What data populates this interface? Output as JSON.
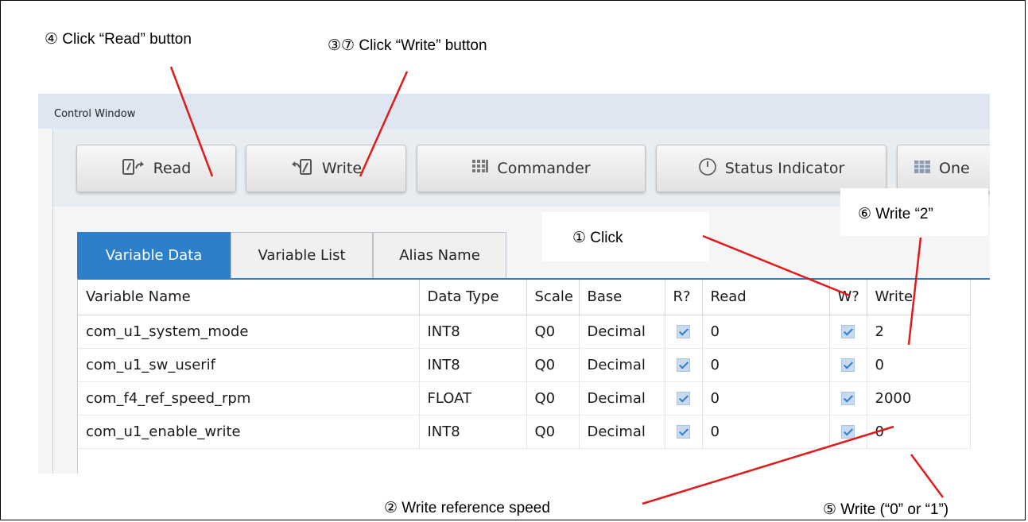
{
  "annotations": {
    "step4": "④ Click “Read” button",
    "step3_7": "③⑦ Click “Write” button",
    "step1": "① Click",
    "step6": "⑥ Write “2”",
    "step2": "② Write reference speed",
    "step5": "⑤ Write (“0” or “1”)"
  },
  "window": {
    "title": "Control Window"
  },
  "toolbar": {
    "read_label": "Read",
    "write_label": "Write",
    "commander_label": "Commander",
    "status_indicator_label": "Status Indicator",
    "one_label": "One"
  },
  "tabs": {
    "variable_data": "Variable Data",
    "variable_list": "Variable List",
    "alias_name": "Alias Name"
  },
  "table": {
    "headers": {
      "variable_name": "Variable Name",
      "data_type": "Data Type",
      "scale": "Scale",
      "base": "Base",
      "r": "R?",
      "read": "Read",
      "w": "W?",
      "write": "Write"
    },
    "rows": [
      {
        "name": "com_u1_system_mode",
        "type": "INT8",
        "scale": "Q0",
        "base": "Decimal",
        "read": "0",
        "write": "2"
      },
      {
        "name": "com_u1_sw_userif",
        "type": "INT8",
        "scale": "Q0",
        "base": "Decimal",
        "read": "0",
        "write": "0"
      },
      {
        "name": "com_f4_ref_speed_rpm",
        "type": "FLOAT",
        "scale": "Q0",
        "base": "Decimal",
        "read": "0",
        "write": "2000"
      },
      {
        "name": "com_u1_enable_write",
        "type": "INT8",
        "scale": "Q0",
        "base": "Decimal",
        "read": "0",
        "write": "0"
      }
    ]
  },
  "colors": {
    "accent": "#2e7fc9",
    "callout_line": "#e01b1b",
    "titlebar": "#dde6f1"
  }
}
